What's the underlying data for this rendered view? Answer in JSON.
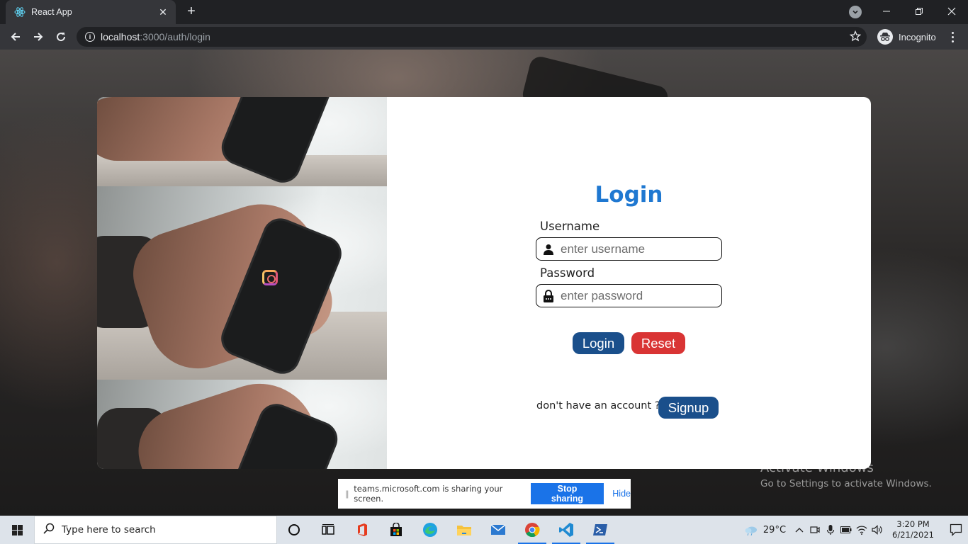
{
  "browser": {
    "tab_title": "React App",
    "url_host": "localhost",
    "url_rest": ":3000/auth/login",
    "profile_label": "Incognito"
  },
  "login": {
    "title": "Login",
    "username_label": "Username",
    "username_placeholder": "enter username",
    "password_label": "Password",
    "password_placeholder": "enter password",
    "login_button": "Login",
    "reset_button": "Reset",
    "signup_prompt": "don't have an account ?",
    "signup_button": "Signup",
    "title_color": "#1f78d1",
    "primary_color": "#1a4f8b",
    "danger_color": "#d93434"
  },
  "watermark": {
    "line1": "Activate Windows",
    "line2": "Go to Settings to activate Windows."
  },
  "share_bar": {
    "message": "teams.microsoft.com is sharing your screen.",
    "stop_label": "Stop sharing",
    "hide_label": "Hide"
  },
  "taskbar": {
    "search_placeholder": "Type here to search",
    "weather": "29°C",
    "time": "3:20 PM",
    "date": "6/21/2021",
    "apps": [
      "cortana-icon",
      "task-view-icon",
      "office-icon",
      "store-icon",
      "edge-icon",
      "file-explorer-icon",
      "mail-icon",
      "chrome-icon",
      "vscode-icon",
      "powershell-icon"
    ]
  }
}
